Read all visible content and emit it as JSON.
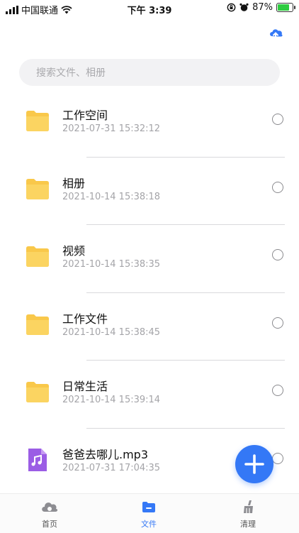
{
  "status_bar": {
    "carrier": "中国联通",
    "time": "下午 3:39",
    "battery_percent": "87%",
    "battery_level": 0.87
  },
  "search": {
    "placeholder": "搜索文件、相册",
    "value": ""
  },
  "files": [
    {
      "name": "工作空间",
      "time": "2021-07-31 15:32:12",
      "type": "folder",
      "selected": false
    },
    {
      "name": "相册",
      "time": "2021-10-14 15:38:18",
      "type": "folder",
      "selected": false
    },
    {
      "name": "视频",
      "time": "2021-10-14 15:38:35",
      "type": "folder",
      "selected": false
    },
    {
      "name": "工作文件",
      "time": "2021-10-14 15:38:45",
      "type": "folder",
      "selected": false
    },
    {
      "name": "日常生活",
      "time": "2021-10-14 15:39:14",
      "type": "folder",
      "selected": false
    },
    {
      "name": " 爸爸去哪儿.mp3",
      "time": "2021-07-31 17:04:35",
      "type": "audio",
      "selected": false
    }
  ],
  "tabbar": {
    "items": [
      {
        "label": "首页",
        "icon": "cloud-home-icon",
        "active": false
      },
      {
        "label": "文件",
        "icon": "folder-icon",
        "active": true
      },
      {
        "label": "清理",
        "icon": "broom-icon",
        "active": false
      }
    ]
  },
  "colors": {
    "accent": "#3478f6",
    "folder": "#f9c84a",
    "audio": "#9b5de5"
  }
}
